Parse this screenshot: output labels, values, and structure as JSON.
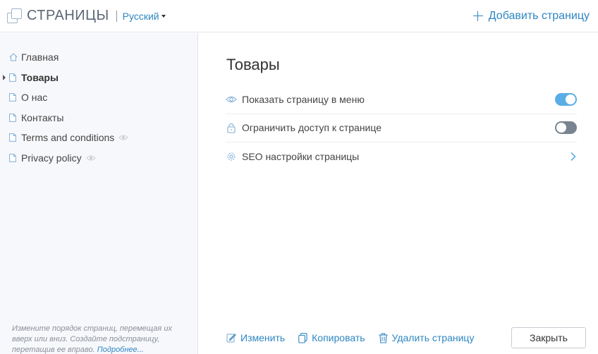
{
  "header": {
    "title": "СТРАНИЦЫ",
    "language": "Русский",
    "add_page_label": "Добавить страницу"
  },
  "sidebar": {
    "items": [
      {
        "label": "Главная",
        "icon": "home-icon",
        "active": false,
        "hidden": false
      },
      {
        "label": "Товары",
        "icon": "document-icon",
        "active": true,
        "hidden": false
      },
      {
        "label": "О нас",
        "icon": "document-icon",
        "active": false,
        "hidden": false
      },
      {
        "label": "Контакты",
        "icon": "document-icon",
        "active": false,
        "hidden": false
      },
      {
        "label": "Terms and conditions",
        "icon": "document-icon",
        "active": false,
        "hidden": true
      },
      {
        "label": "Privacy policy",
        "icon": "document-icon",
        "active": false,
        "hidden": true
      }
    ],
    "hint_text": "Измените порядок страниц, перемещая их вверх или вниз. Создайте подстраницу, перетащив ее вправо.",
    "hint_link": "Подробнее..."
  },
  "main": {
    "page_title": "Товары",
    "settings": [
      {
        "label": "Показать страницу в меню",
        "icon": "eye-icon",
        "control": "toggle",
        "on": true
      },
      {
        "label": "Ограничить доступ к странице",
        "icon": "lock-icon",
        "control": "toggle",
        "on": false
      },
      {
        "label": "SEO настройки страницы",
        "icon": "gear-icon",
        "control": "chevron"
      }
    ],
    "actions": {
      "edit_label": "Изменить",
      "copy_label": "Копировать",
      "delete_label": "Удалить страницу",
      "close_label": "Закрыть"
    }
  },
  "colors": {
    "accent": "#2e86c1",
    "toggle_on": "#5aaee6",
    "toggle_off": "#7a8390",
    "sidebar_bg": "#f7f8fb"
  }
}
